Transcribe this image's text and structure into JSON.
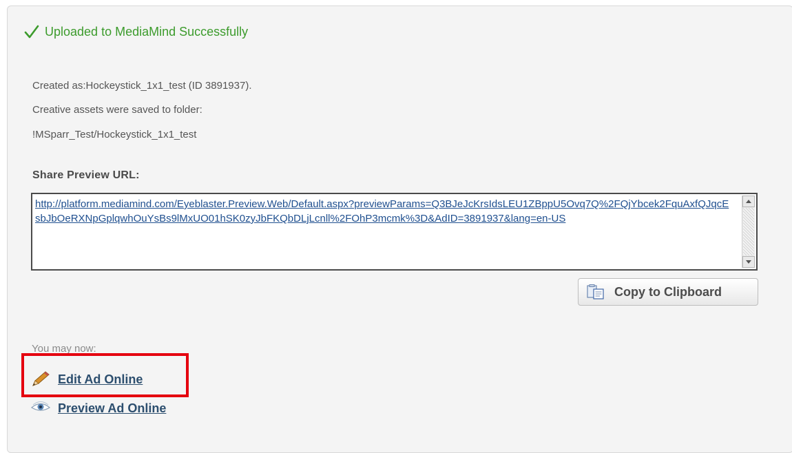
{
  "status": {
    "message": "Uploaded to MediaMind Successfully",
    "icon": "checkmark-icon",
    "color": "#3c9b2c"
  },
  "info": {
    "created_as": "Created as:Hockeystick_1x1_test (ID 3891937).",
    "saved_to": "Creative assets were saved to folder:",
    "folder_path": "!MSparr_Test/Hockeystick_1x1_test"
  },
  "share": {
    "label": "Share Preview URL:",
    "url": "http://platform.mediamind.com/Eyeblaster.Preview.Web/Default.aspx?previewParams=Q3BJeJcKrsIdsLEU1ZBppU5Ovq7Q%2FQjYbcek2FquAxfQJqcEsbJbOeRXNpGplqwhOuYsBs9lMxUO01hSK0zyJbFKQbDLjLcnll%2FOhP3mcmk%3D&AdID=3891937&lang=en-US",
    "copy_button": "Copy to Clipboard"
  },
  "next": {
    "heading": "You may now:",
    "actions": [
      {
        "label": "Edit Ad Online",
        "icon": "pencil-icon"
      },
      {
        "label": "Preview Ad Online",
        "icon": "eye-icon"
      }
    ]
  },
  "highlight_color": "#e5000f"
}
